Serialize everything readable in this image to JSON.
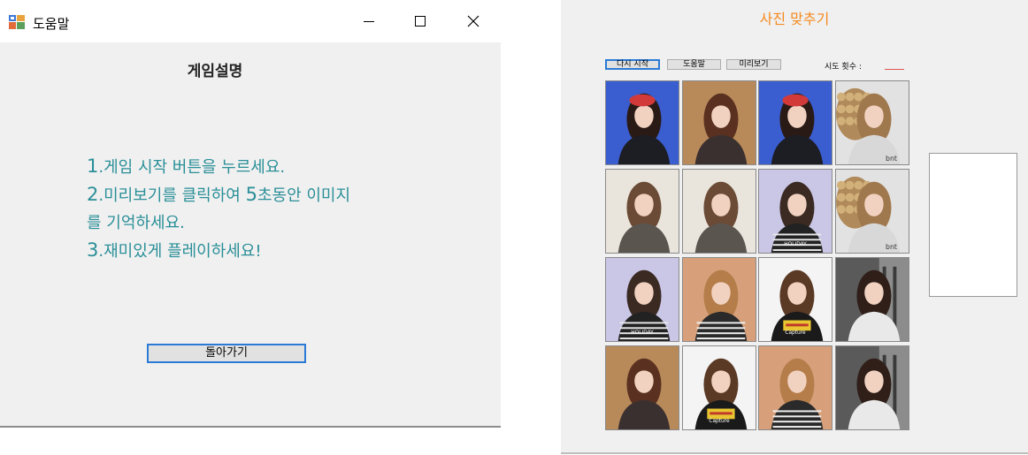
{
  "help_window": {
    "title": "도움말",
    "heading": "게임설명",
    "lines": [
      {
        "num": "1",
        "text": ".게임 시작 버튼을 누르세요."
      },
      {
        "num": "2",
        "text": ".미리보기를 클릭하여 ",
        "num2": "5",
        "text2": "초동안 이미지"
      },
      {
        "num": "",
        "text": "를 기억하세요."
      },
      {
        "num": "3",
        "text": ".재미있게 플레이하세요!"
      }
    ],
    "back_button": "돌아가기"
  },
  "game_window": {
    "title": "사진 맞추기",
    "buttons": {
      "restart": "다시 시작",
      "help": "도움말",
      "preview": "미리보기"
    },
    "tries_label": "시도 횟수 :",
    "tries_value": "",
    "cards": [
      [
        "photo-red-beret",
        "photo-brown-hair",
        "photo-red-beret",
        "photo-bnt-flowers"
      ],
      [
        "photo-long-hair",
        "photo-long-hair",
        "photo-holiday-shirt",
        "photo-bnt-flowers"
      ],
      [
        "photo-holiday-shirt",
        "photo-wavy-hair",
        "photo-capture-shirt",
        "photo-sitting"
      ],
      [
        "photo-brown-hair",
        "photo-capture-shirt",
        "photo-wavy-hair",
        "photo-sitting"
      ]
    ],
    "card_labels": {
      "photo-bnt-flowers": "bnt",
      "photo-holiday-shirt": "HOLIDAY",
      "photo-capture-shirt": "Capture"
    }
  },
  "colors": {
    "instruction_text": "#2a8f98",
    "game_title": "#f5891f",
    "focus_border": "#2b7bd6",
    "window_bg": "#f0f0f0"
  }
}
